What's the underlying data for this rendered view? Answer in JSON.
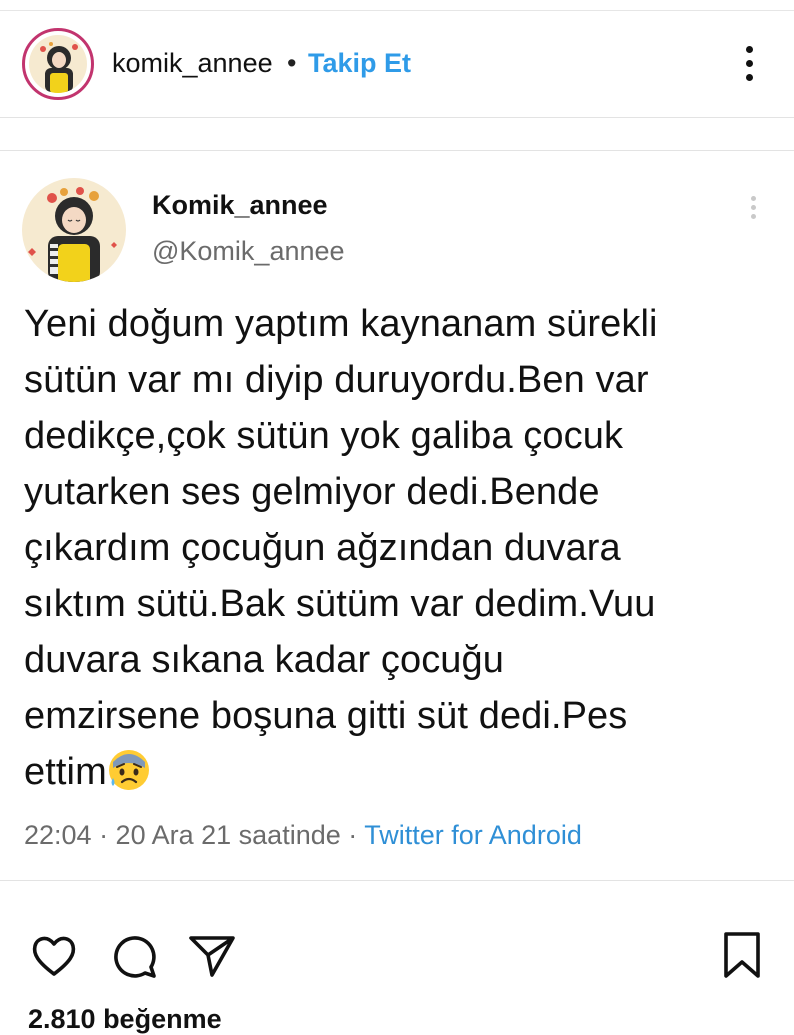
{
  "post_header": {
    "username": "komik_annee",
    "separator": "•",
    "follow_label": "Takip Et"
  },
  "tweet": {
    "display_name": "Komik_annee",
    "handle": "@Komik_annee",
    "lines": [
      "Yeni doğum yaptım kaynanam sürekli",
      "sütün var mı diyip duruyordu.Ben var",
      "dedikçe,çok sütün yok galiba çocuk",
      "yutarken ses gelmiyor dedi.Bende",
      "çıkardım çocuğun ağzından duvara",
      "sıktım sütü.Bak sütüm var dedim.Vuu",
      "duvara sıkana kadar çocuğu",
      "emzirsene boşuna gitti süt dedi.Pes",
      "ettim"
    ],
    "emoji_icon": "anxious-face-with-sweat-icon",
    "meta_time": "22:04 · 20 Ara 21 saatinde · ",
    "meta_source": "Twitter for Android"
  },
  "actions": {
    "icons": [
      "heart-icon",
      "comment-icon",
      "share-icon",
      "bookmark-icon"
    ]
  },
  "likes_text": "2.810 beğenme",
  "colors": {
    "follow": "#2f9be8",
    "twitter_source": "#2f8fd6",
    "avatar_ring": "#c2346e"
  }
}
